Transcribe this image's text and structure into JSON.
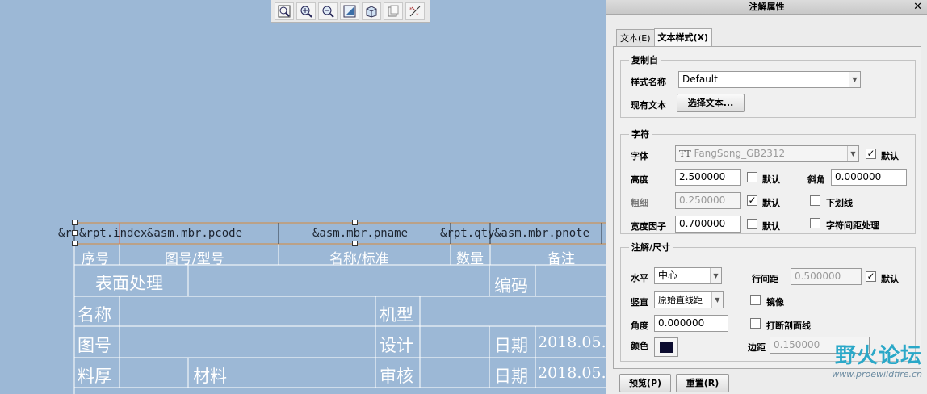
{
  "toolbar": {
    "buttons": [
      "zoom-fit-icon",
      "zoom-in-icon",
      "zoom-out-icon",
      "repaint-icon",
      "view-orient-icon",
      "saved-views-icon",
      "display-toggle-icon"
    ]
  },
  "drawing": {
    "param_row": {
      "index": "&rpt.index",
      "prefix": "&r",
      "pcode": "&asm.mbr.pcode",
      "pname": "&asm.mbr.pname",
      "qty": "&rpt.qty",
      "pnote": "&asm.mbr.pnote"
    },
    "header_row": {
      "seq": "序号",
      "code": "图号/型号",
      "name": "名称/标准",
      "count": "数量",
      "note": "备注"
    },
    "title_block": {
      "surface": "表面处理",
      "number": "编码",
      "name": "名称",
      "model": "机型",
      "drawing_no": "图号",
      "design": "设计",
      "date1": "日期",
      "date1_val": "2018.05.",
      "thickness": "料厚",
      "material": "材料",
      "review": "审核",
      "date2": "日期",
      "date2_val": "2018.05."
    }
  },
  "panel": {
    "title": "注解属性",
    "close": "✕",
    "tabs": [
      {
        "label": "文本(E)",
        "active": false
      },
      {
        "label": "文本样式(X)",
        "active": true
      }
    ],
    "copy_from": {
      "legend": "复制自",
      "style_name_label": "样式名称",
      "style_name_value": "Default",
      "existing_text_label": "现有文本",
      "select_text_button": "选择文本..."
    },
    "char": {
      "legend": "字符",
      "font_label": "字体",
      "font_value": "FangSong_GB2312",
      "font_default_label": "默认",
      "font_default_checked": true,
      "height_label": "高度",
      "height_value": "2.500000",
      "height_default_label": "默认",
      "height_default_checked": false,
      "slant_label": "斜角",
      "slant_value": "0.000000",
      "thickness_label": "粗细",
      "thickness_value": "0.250000",
      "thickness_default_label": "默认",
      "thickness_default_checked": true,
      "underline_label": "下划线",
      "underline_checked": false,
      "width_factor_label": "宽度因子",
      "width_factor_value": "0.700000",
      "width_default_label": "默认",
      "width_default_checked": false,
      "kerning_label": "字符间距处理",
      "kerning_checked": false
    },
    "note_dim": {
      "legend": "注解/尺寸",
      "horizontal_label": "水平",
      "horizontal_value": "中心",
      "line_spacing_label": "行间距",
      "line_spacing_value": "0.500000",
      "line_spacing_default_label": "默认",
      "line_spacing_default_checked": true,
      "vertical_label": "竖直",
      "vertical_value": "原始直线距",
      "mirror_label": "镜像",
      "mirror_checked": false,
      "angle_label": "角度",
      "angle_value": "0.000000",
      "break_hatch_label": "打断剖面线",
      "break_hatch_checked": false,
      "color_label": "颜色",
      "color_value": "#0b0b2e",
      "margin_label": "边距",
      "margin_value": "0.150000"
    },
    "preview_button": "预览(P)",
    "reset_button": "重置(R)",
    "watermark_big": "野火论坛",
    "watermark_url": "www.proewildfire.cn"
  }
}
